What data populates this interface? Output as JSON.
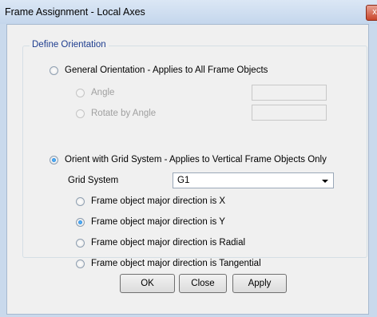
{
  "window": {
    "title": "Frame Assignment - Local Axes",
    "close_glyph": "x"
  },
  "orientation_group": {
    "legend": "Define Orientation",
    "general": {
      "label": "General Orientation - Applies to All Frame Objects",
      "checked": false,
      "angle_label": "Angle",
      "angle_value": "",
      "rotate_label": "Rotate by Angle",
      "rotate_value": ""
    },
    "grid": {
      "label": "Orient with Grid System - Applies to Vertical Frame Objects Only",
      "checked": true,
      "grid_system_label": "Grid System",
      "grid_system_value": "G1",
      "directions": [
        {
          "label": "Frame object major direction is X",
          "checked": false
        },
        {
          "label": "Frame object major direction is Y",
          "checked": true
        },
        {
          "label": "Frame object major direction is Radial",
          "checked": false
        },
        {
          "label": "Frame object major direction is Tangential",
          "checked": false
        }
      ]
    }
  },
  "buttons": {
    "ok": "OK",
    "close": "Close",
    "apply": "Apply"
  },
  "colors": {
    "legend": "#1e3d8f",
    "title_bar": "#c4d6ec",
    "radio_selected": "#1a6fd0"
  }
}
